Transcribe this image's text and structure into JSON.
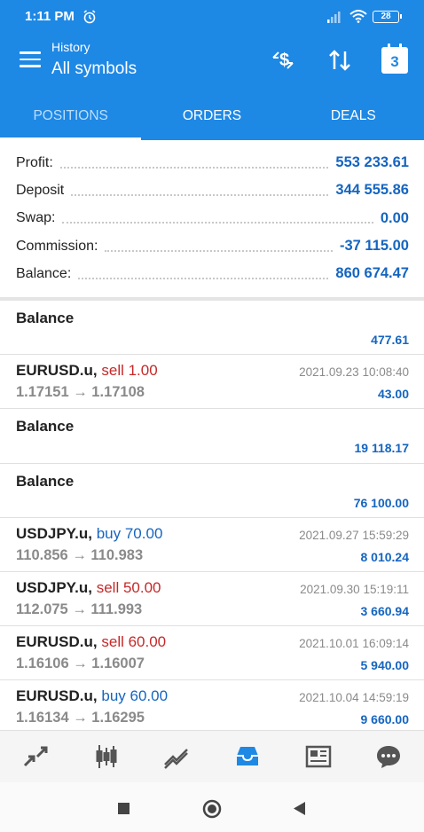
{
  "status_bar": {
    "time": "1:11 PM",
    "battery": "28"
  },
  "app_bar": {
    "subtitle": "History",
    "title": "All symbols",
    "calendar_day": "3"
  },
  "tabs": [
    {
      "label": "POSITIONS"
    },
    {
      "label": "ORDERS"
    },
    {
      "label": "DEALS"
    }
  ],
  "summary": [
    {
      "label": "Profit:",
      "value": "553 233.61"
    },
    {
      "label": "Deposit",
      "value": "344 555.86"
    },
    {
      "label": "Swap:",
      "value": "0.00"
    },
    {
      "label": "Commission:",
      "value": "-37 115.00"
    },
    {
      "label": "Balance:",
      "value": "860 674.47"
    }
  ],
  "deals": [
    {
      "title": "Balance",
      "profit": "477.61"
    },
    {
      "symbol": "EURUSD.u,",
      "side": "sell 1.00",
      "prices": "1.17151 → 1.17108",
      "time": "2021.09.23 10:08:40",
      "profit": "43.00"
    },
    {
      "title": "Balance",
      "profit": "19 118.17"
    },
    {
      "title": "Balance",
      "profit": "76 100.00"
    },
    {
      "symbol": "USDJPY.u,",
      "side": "buy 70.00",
      "prices": "110.856 → 110.983",
      "time": "2021.09.27 15:59:29",
      "profit": "8 010.24"
    },
    {
      "symbol": "USDJPY.u,",
      "side": "sell 50.00",
      "prices": "112.075 → 111.993",
      "time": "2021.09.30 15:19:11",
      "profit": "3 660.94"
    },
    {
      "symbol": "EURUSD.u,",
      "side": "sell 60.00",
      "prices": "1.16106 → 1.16007",
      "time": "2021.10.01 16:09:14",
      "profit": "5 940.00"
    },
    {
      "symbol": "EURUSD.u,",
      "side": "buy 60.00",
      "prices": "1.16134 → 1.16295",
      "time": "2021.10.04 14:59:19",
      "profit": "9 660.00"
    }
  ],
  "bottom_nav": [
    {
      "icon": "quotes-icon"
    },
    {
      "icon": "chart-icon"
    },
    {
      "icon": "trade-icon"
    },
    {
      "icon": "history-icon"
    },
    {
      "icon": "news-icon"
    },
    {
      "icon": "chat-icon"
    }
  ],
  "colors": {
    "primary": "#1e88e5",
    "profit": "#1565c0",
    "sell": "#c62828",
    "muted": "#8a8a8a"
  }
}
